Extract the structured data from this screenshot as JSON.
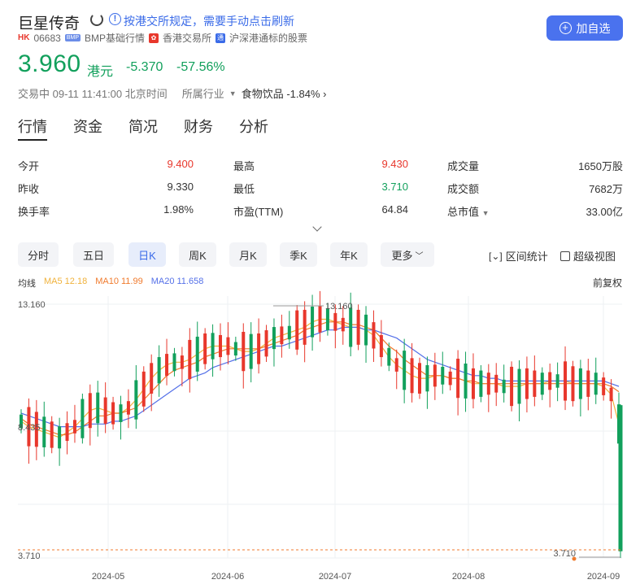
{
  "header": {
    "name": "巨星传奇",
    "notice": "按港交所规定，需要手动点击刷新",
    "market_badge": "HK",
    "code": "06683",
    "bmp_badge": "BMP",
    "bmp_text": "BMP基础行情",
    "hkex_text": "香港交易所",
    "connect_text": "沪深港通标的股票",
    "watch_label": "加自选"
  },
  "quote": {
    "price": "3.960",
    "currency": "港元",
    "change": "-5.370",
    "change_pct": "-57.56%",
    "status": "交易中 09-11 11:41:00 北京时间",
    "industry_label": "所属行业",
    "industry": "食物饮品",
    "industry_change": "-1.84%"
  },
  "tabs": [
    "行情",
    "资金",
    "简况",
    "财务",
    "分析"
  ],
  "stats": {
    "open_label": "今开",
    "open": "9.400",
    "prev_label": "昨收",
    "prev": "9.330",
    "turnover_label": "换手率",
    "turnover": "1.98%",
    "high_label": "最高",
    "high": "9.430",
    "low_label": "最低",
    "low": "3.710",
    "pe_label": "市盈(TTM)",
    "pe": "64.84",
    "volume_label": "成交量",
    "volume": "1650万股",
    "amount_label": "成交额",
    "amount": "7682万",
    "mcap_label": "总市值",
    "mcap": "33.00亿"
  },
  "periods": [
    "分时",
    "五日",
    "日K",
    "周K",
    "月K",
    "季K",
    "年K",
    "更多"
  ],
  "tools": {
    "interval": "区间统计",
    "advanced": "超级视图"
  },
  "ma": {
    "title": "均线",
    "ma5": "MA5 12.18",
    "ma10": "MA10 11.99",
    "ma20": "MA20 11.658",
    "adjust": "前复权"
  },
  "colors": {
    "up": "#e8372c",
    "down": "#12a05c",
    "accent": "#3a6be8",
    "ma5": "#f0b23c",
    "ma10": "#f07a2c",
    "ma20": "#5470e8"
  },
  "chart_data": {
    "type": "candlestick",
    "y_ticks": [
      "13.160",
      "8.435",
      "3.710"
    ],
    "ylim": [
      3.71,
      13.16
    ],
    "x_ticks": [
      "2024-05",
      "2024-06",
      "2024-07",
      "2024-08",
      "2024-09"
    ],
    "max_label": "13.160",
    "min_label": "3.710",
    "series": [
      {
        "name": "MA5",
        "values": [
          8.8,
          8.6,
          8.5,
          8.4,
          8.3,
          8.2,
          8.4,
          8.6,
          8.9,
          9.2,
          9.3,
          9.2,
          9.1,
          9.1,
          9.3,
          9.6,
          10.0,
          10.4,
          10.7,
          10.9,
          11.0,
          11.0,
          11.1,
          11.3,
          11.5,
          11.6,
          11.6,
          11.6,
          11.5,
          11.4,
          11.4,
          11.5,
          11.7,
          11.9,
          12.0,
          12.1,
          12.2,
          12.3,
          12.5,
          12.6,
          12.6,
          12.5,
          12.4,
          12.3,
          12.3,
          12.2,
          12.0,
          11.6,
          11.2,
          10.9,
          10.7,
          10.5,
          10.4,
          10.4,
          10.5,
          10.5,
          10.4,
          10.4,
          10.3,
          10.2,
          10.2,
          10.2,
          10.2,
          10.1,
          10.1,
          10.1,
          10.2,
          10.2,
          10.2,
          10.3,
          10.3,
          10.3,
          10.2,
          10.2,
          10.2,
          10.2,
          10.1,
          9.8,
          8.7
        ]
      },
      {
        "name": "MA10",
        "values": [
          8.9,
          8.7,
          8.6,
          8.5,
          8.4,
          8.3,
          8.3,
          8.4,
          8.6,
          8.8,
          9.0,
          9.0,
          9.1,
          9.1,
          9.2,
          9.3,
          9.6,
          9.9,
          10.2,
          10.5,
          10.7,
          10.8,
          10.9,
          11.0,
          11.2,
          11.3,
          11.4,
          11.5,
          11.5,
          11.5,
          11.5,
          11.5,
          11.6,
          11.7,
          11.8,
          11.9,
          12.0,
          12.2,
          12.3,
          12.4,
          12.5,
          12.5,
          12.5,
          12.4,
          12.4,
          12.3,
          12.2,
          11.9,
          11.6,
          11.4,
          11.1,
          10.9,
          10.7,
          10.5,
          10.5,
          10.5,
          10.4,
          10.4,
          10.3,
          10.3,
          10.2,
          10.2,
          10.2,
          10.2,
          10.2,
          10.2,
          10.2,
          10.2,
          10.2,
          10.2,
          10.2,
          10.2,
          10.2,
          10.2,
          10.2,
          10.2,
          10.2,
          10.1,
          9.9
        ]
      },
      {
        "name": "MA20",
        "values": [
          9.1,
          9.0,
          8.9,
          8.8,
          8.7,
          8.6,
          8.6,
          8.6,
          8.6,
          8.7,
          8.7,
          8.7,
          8.8,
          8.8,
          8.9,
          9.0,
          9.2,
          9.4,
          9.6,
          9.8,
          10.0,
          10.2,
          10.4,
          10.5,
          10.6,
          10.8,
          10.9,
          11.0,
          11.1,
          11.2,
          11.3,
          11.4,
          11.5,
          11.6,
          11.6,
          11.7,
          11.8,
          11.9,
          12.0,
          12.1,
          12.2,
          12.2,
          12.3,
          12.3,
          12.3,
          12.2,
          12.2,
          12.1,
          12.0,
          11.9,
          11.7,
          11.5,
          11.3,
          11.1,
          11.0,
          10.9,
          10.8,
          10.7,
          10.6,
          10.5,
          10.5,
          10.4,
          10.4,
          10.3,
          10.3,
          10.3,
          10.3,
          10.3,
          10.3,
          10.3,
          10.3,
          10.3,
          10.3,
          10.3,
          10.3,
          10.3,
          10.3,
          10.2,
          10.1
        ]
      }
    ]
  }
}
